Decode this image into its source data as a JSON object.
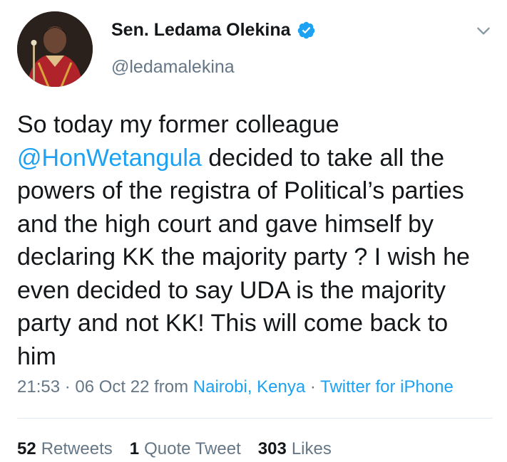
{
  "author": {
    "display_name": "Sen. Ledama Olekina",
    "handle": "@ledamalekina",
    "verified": true
  },
  "tweet": {
    "text_part1": "So today my former colleague",
    "mention": "@HonWetangula",
    "text_part2": " decided to take all the powers of the registra of Political’s parties and the high court and gave himself by declaring KK the majority party ? I wish he even decided to say UDA is the majority party and not KK! This will come back to him"
  },
  "meta": {
    "time": "21:53",
    "separator": " · ",
    "date": "06 Oct 22",
    "from_label": " from ",
    "location": "Nairobi, Kenya",
    "source": "Twitter for iPhone"
  },
  "stats": {
    "retweets_count": "52",
    "retweets_label": "Retweets",
    "quote_count": "1",
    "quote_label": "Quote Tweet",
    "likes_count": "303",
    "likes_label": "Likes"
  },
  "icons": {
    "verified": "verified-badge-icon",
    "more": "chevron-down-icon"
  },
  "colors": {
    "link": "#1da1f2",
    "secondary_text": "#657786",
    "primary_text": "#14171a"
  }
}
